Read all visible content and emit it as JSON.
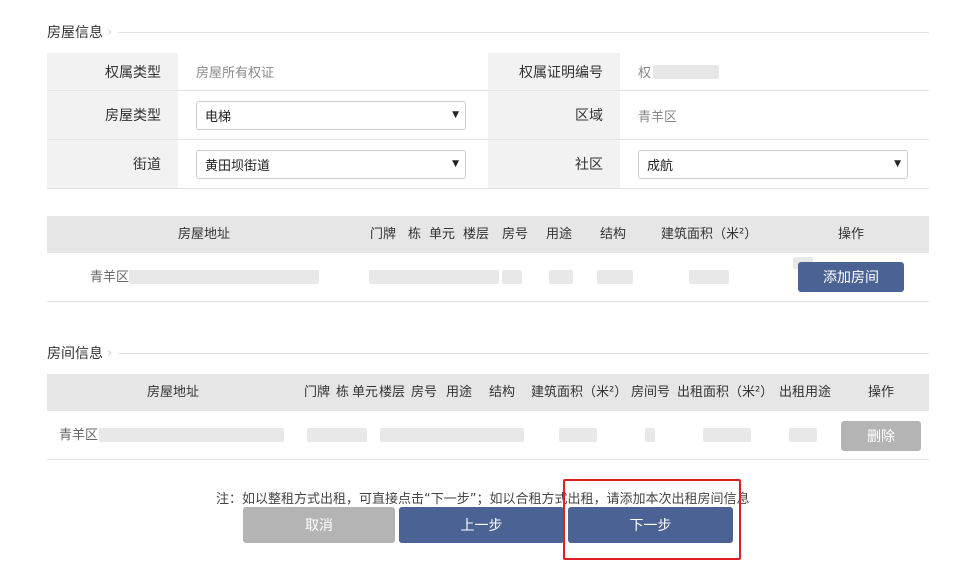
{
  "house_section": {
    "title": "房屋信息"
  },
  "house_info": {
    "ownership_type_label": "权属类型",
    "ownership_type_value": "房屋所有权证",
    "cert_no_label": "权属证明编号",
    "cert_no_value": "权",
    "house_type_label": "房屋类型",
    "house_type_value": "电梯",
    "region_label": "区域",
    "region_value": "青羊区",
    "street_label": "街道",
    "street_value": "黄田坝街道",
    "community_label": "社区",
    "community_value": "成航"
  },
  "house_table": {
    "headers": [
      "房屋地址",
      "门牌",
      "栋",
      "单元",
      "楼层",
      "房号",
      "用途",
      "结构",
      "建筑面积（米²）",
      "操作"
    ],
    "row_address_prefix": "青羊区",
    "add_room_label": "添加房间"
  },
  "room_section": {
    "title": "房间信息"
  },
  "room_table": {
    "headers": [
      "房屋地址",
      "门牌",
      "栋",
      "单元",
      "楼层",
      "房号",
      "用途",
      "结构",
      "建筑面积（米²）",
      "房间号",
      "出租面积（米²）",
      "出租用途",
      "操作"
    ],
    "row_address_prefix": "青羊区",
    "delete_label": "删除"
  },
  "note": "注：如以整租方式出租，可直接点击“下一步”；如以合租方式出租，请添加本次出租房间信息",
  "buttons": {
    "cancel": "取消",
    "prev": "上一步",
    "next": "下一步"
  },
  "colors": {
    "primary": "#4b6394",
    "disabled": "#b4b4b4",
    "highlight": "#e02020"
  },
  "icons": {
    "section_arrow": "chevron-right-icon",
    "select_caret": "caret-down-icon"
  }
}
